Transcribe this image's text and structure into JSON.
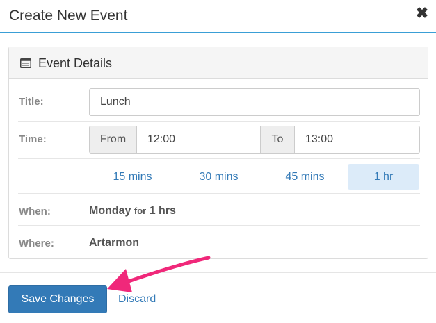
{
  "header": {
    "title": "Create New Event",
    "close_glyph": "✖"
  },
  "panel": {
    "title": "Event Details",
    "icon": "list-alt-icon"
  },
  "form": {
    "title_label": "Title:",
    "title_value": "Lunch",
    "time_label": "Time:",
    "from_label": "From",
    "from_value": "12:00",
    "to_label": "To",
    "to_value": "13:00",
    "durations": [
      "15 mins",
      "30 mins",
      "45 mins",
      "1 hr"
    ],
    "selected_duration": "1 hr",
    "when_label": "When:",
    "when_day": "Monday",
    "when_for": "for",
    "when_length": "1 hrs",
    "where_label": "Where:",
    "where_value": "Artarmon"
  },
  "footer": {
    "save_label": "Save Changes",
    "discard_label": "Discard"
  },
  "colors": {
    "accent": "#337ab7",
    "header_rule": "#3a9fd6",
    "selected_bg": "#dcebf9",
    "arrow": "#f0287a"
  }
}
